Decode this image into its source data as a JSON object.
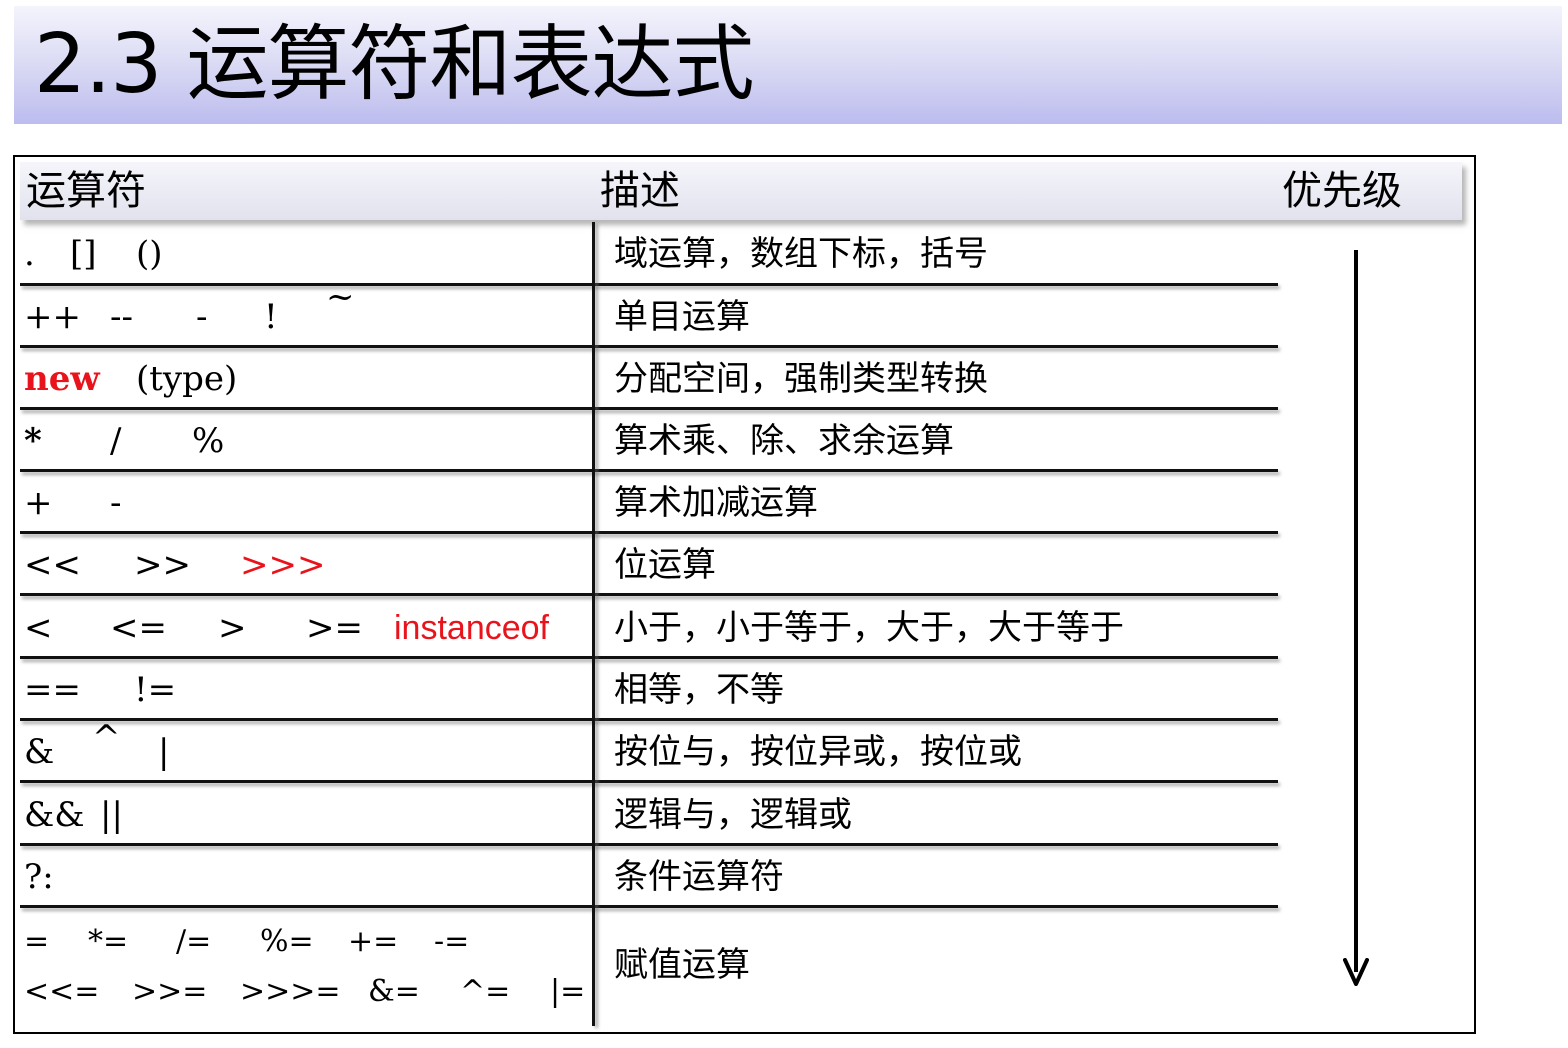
{
  "slide": {
    "title": "2.3 运算符和表达式"
  },
  "table": {
    "headers": {
      "operator": "运算符",
      "description": "描述",
      "precedence": "优先级"
    },
    "rows": [
      {
        "ops": [
          ".",
          "[]",
          "()"
        ],
        "desc": "域运算，数组下标，括号"
      },
      {
        "ops": [
          "++",
          "--",
          "-",
          "!",
          "~"
        ],
        "desc": "单目运算"
      },
      {
        "ops": [
          "new",
          "(type)"
        ],
        "desc": "分配空间，强制类型转换"
      },
      {
        "ops": [
          "*",
          "/",
          "%"
        ],
        "desc": "算术乘、除、求余运算"
      },
      {
        "ops": [
          "+",
          "-"
        ],
        "desc": "算术加减运算"
      },
      {
        "ops": [
          "<<",
          ">>",
          ">>>"
        ],
        "desc": "位运算"
      },
      {
        "ops": [
          "<",
          "<=",
          ">",
          ">=",
          "instanceof"
        ],
        "desc": "小于，小于等于，大于，大于等于"
      },
      {
        "ops": [
          "==",
          "!="
        ],
        "desc": "相等，不等"
      },
      {
        "ops": [
          "&",
          "^",
          "|"
        ],
        "desc": "按位与，按位异或，按位或"
      },
      {
        "ops": [
          "&&",
          "||"
        ],
        "desc": "逻辑与，逻辑或"
      },
      {
        "ops": [
          "?:"
        ],
        "desc": "条件运算符"
      },
      {
        "ops": [
          "=",
          "*=",
          "/=",
          "%=",
          "+=",
          "-=",
          "<<=",
          ">>=",
          ">>>=",
          "&=",
          "^=",
          "|="
        ],
        "desc": "赋值运算"
      }
    ]
  },
  "colors": {
    "highlight": "#e8131b",
    "title_gradient_top": "#f4f4fd",
    "title_gradient_bottom": "#bcbcef"
  },
  "icons": {
    "precedence_arrow": "arrow-down-icon"
  }
}
